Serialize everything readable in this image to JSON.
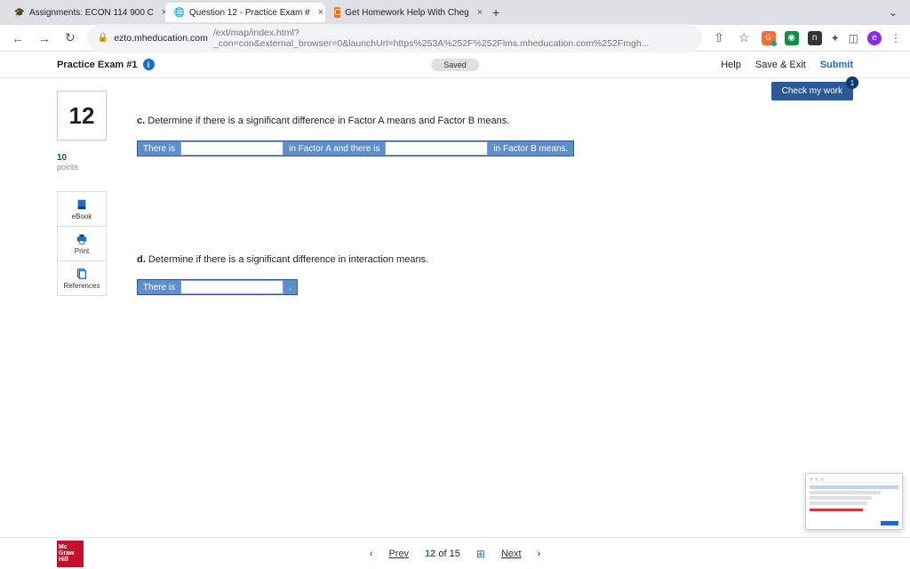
{
  "browser": {
    "tabs": [
      {
        "icon": "🎓",
        "title": "Assignments: ECON 114 900 C"
      },
      {
        "icon": "🌐",
        "title": "Question 12 - Practice Exam #"
      },
      {
        "icon": "C",
        "title": "Get Homework Help With Cheg"
      }
    ],
    "url_domain": "ezto.mheducation.com",
    "url_path": "/ext/map/index.html?_con=con&external_browser=0&launchUrl=https%253A%252F%252Flms.mheducation.com%252Fmgh..."
  },
  "header": {
    "title": "Practice Exam #1",
    "saved": "Saved",
    "help": "Help",
    "save_exit": "Save & Exit",
    "submit": "Submit"
  },
  "check_work": {
    "label": "Check my work",
    "badge": "1"
  },
  "sidebar": {
    "qnum": "12",
    "points_num": "10",
    "points_lbl": "points",
    "tools": [
      {
        "label": "eBook"
      },
      {
        "label": "Print"
      },
      {
        "label": "References"
      }
    ]
  },
  "question": {
    "c_label": "c.",
    "c_text": "Determine if there is a significant difference in Factor A means and Factor B means.",
    "c_seg1": "There is",
    "c_seg2": "in Factor A and there is",
    "c_seg3": "in Factor B means.",
    "d_label": "d.",
    "d_text": "Determine if there is a significant difference in interaction means.",
    "d_seg1": "There is",
    "d_seg2": "."
  },
  "footer": {
    "logo1": "Mc",
    "logo2": "Graw",
    "logo3": "Hill",
    "prev": "Prev",
    "next": "Next",
    "cur": "12",
    "of": "of",
    "total": "15"
  }
}
